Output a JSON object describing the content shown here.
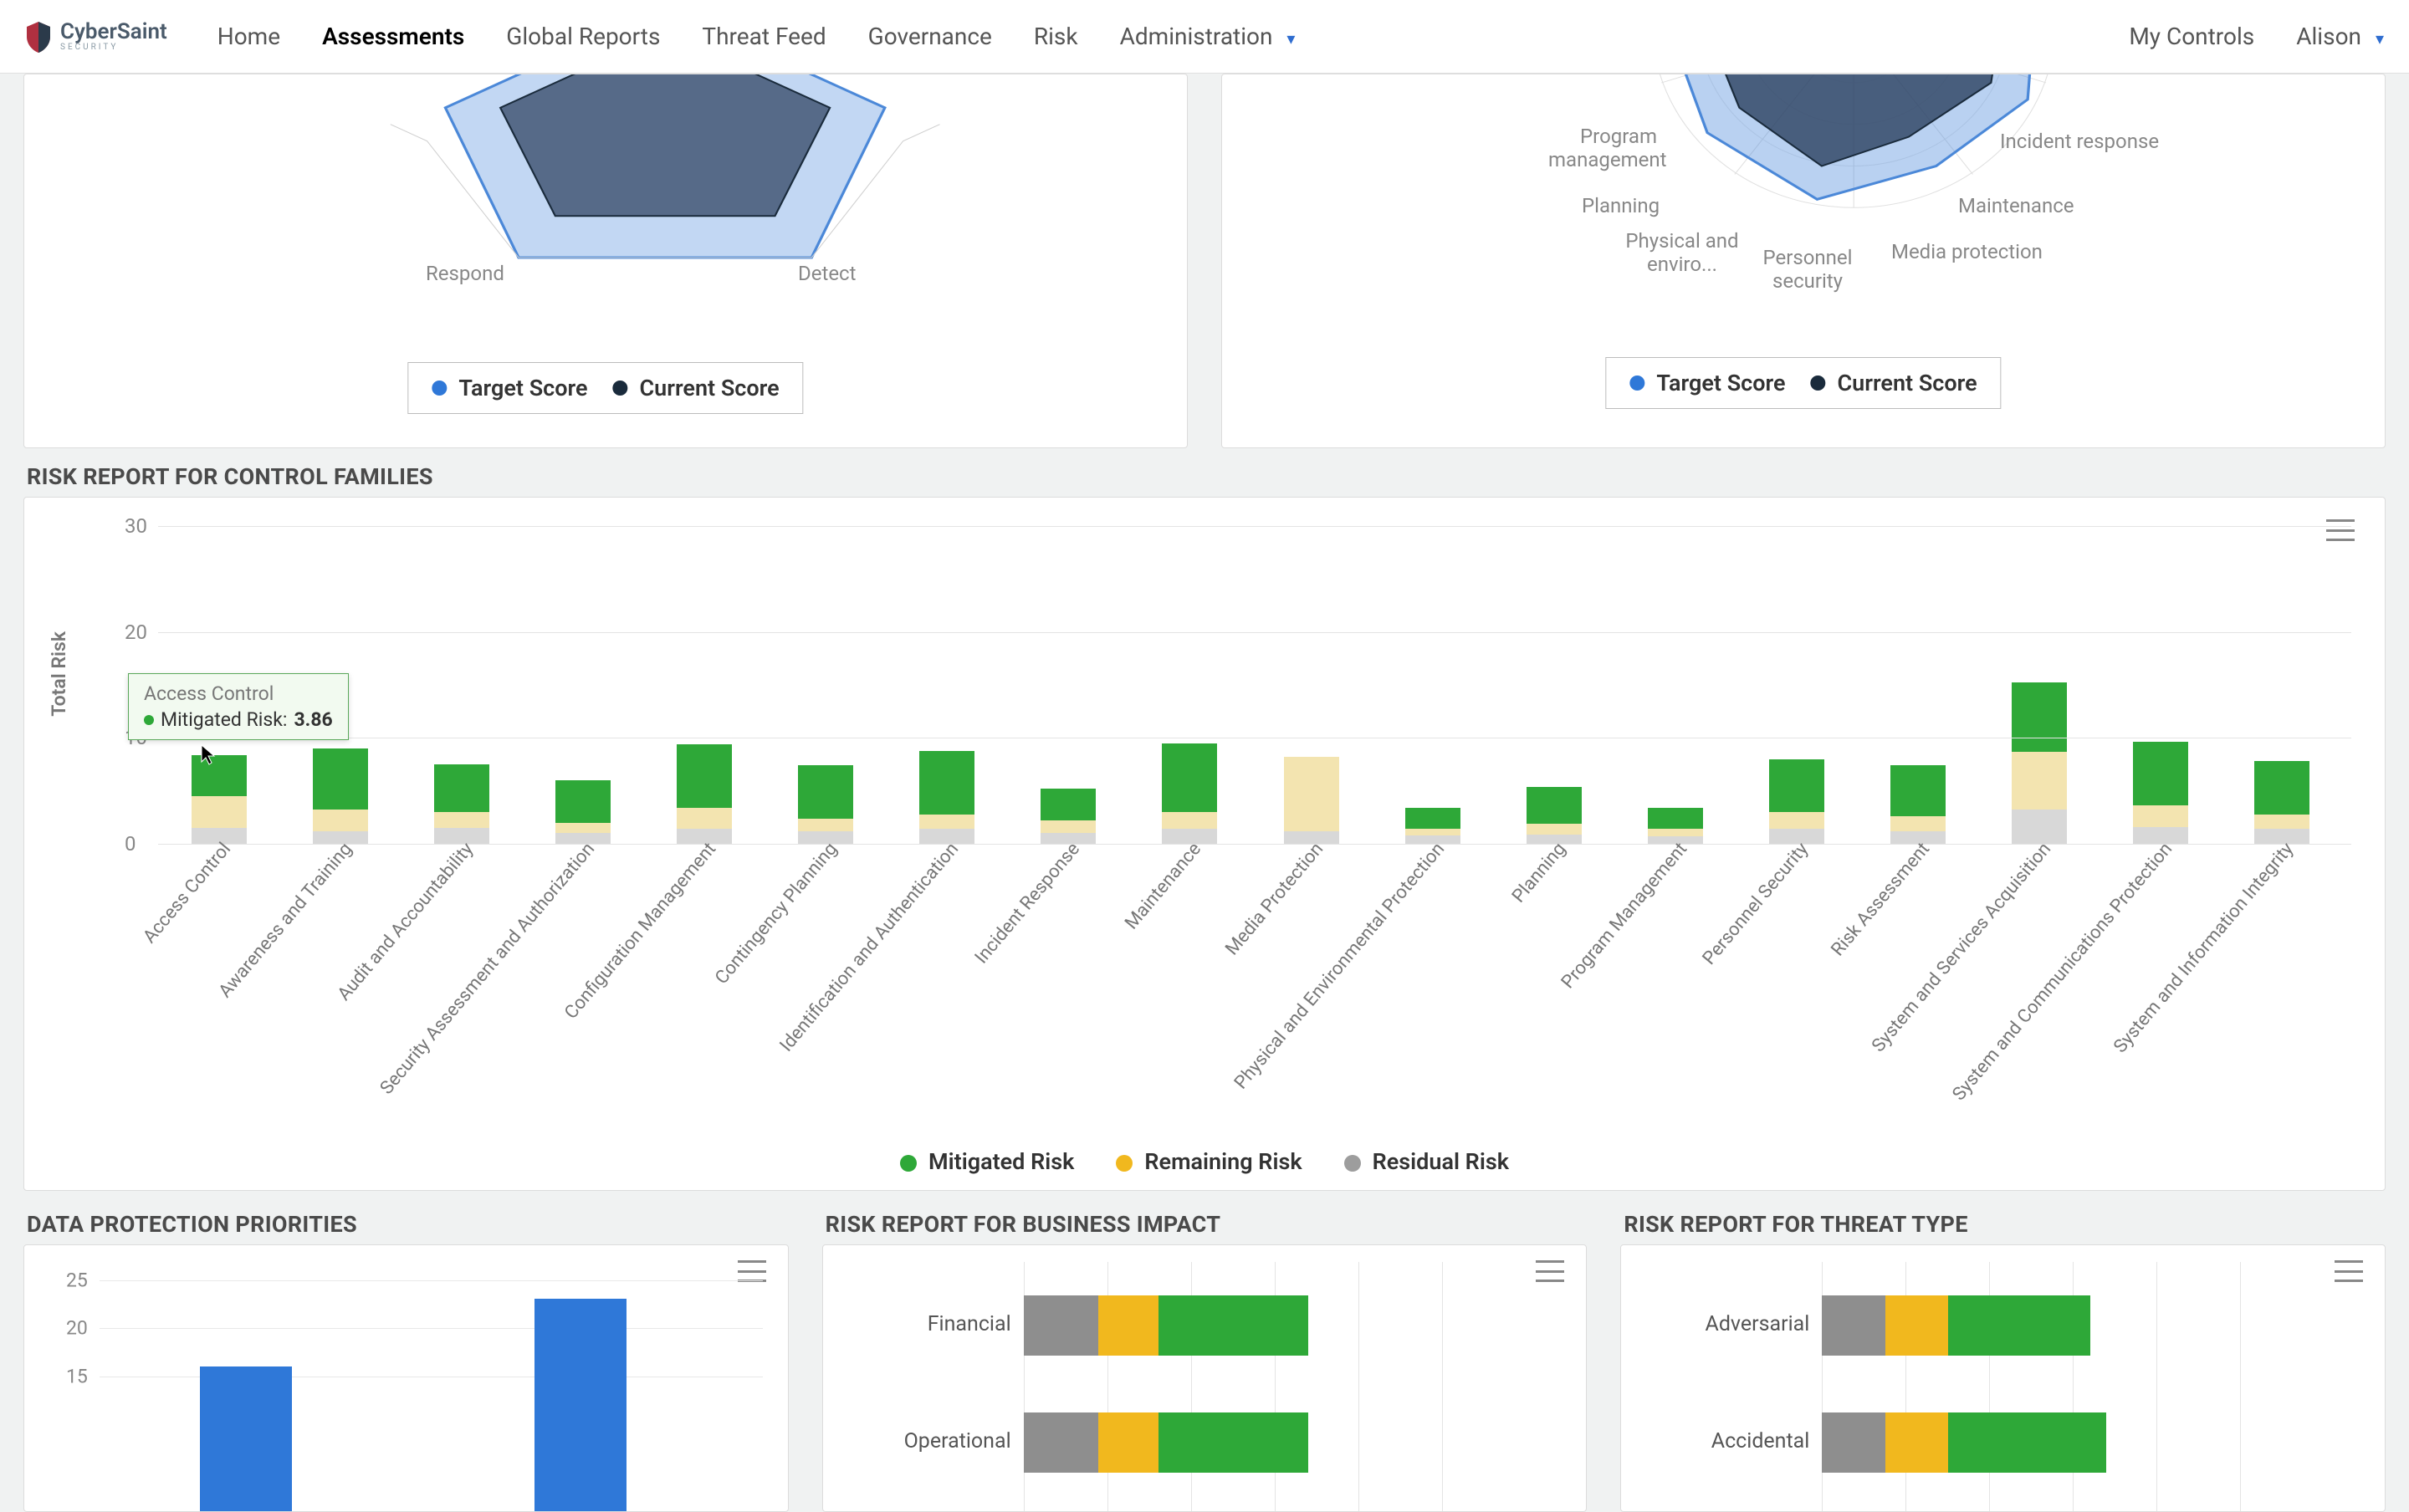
{
  "brand": {
    "name": "CyberSaint",
    "sub": "SECURITY"
  },
  "nav": {
    "items": [
      "Home",
      "Assessments",
      "Global Reports",
      "Threat Feed",
      "Governance",
      "Risk",
      "Administration"
    ],
    "active": "Assessments",
    "right": {
      "my_controls": "My Controls",
      "user": "Alison"
    }
  },
  "colors": {
    "mitigated": "#2ea838",
    "remaining": "#f1b81e",
    "residual": "#9d9d9d",
    "blue": "#2f78d8",
    "dark": "#1a2b3c"
  },
  "radar_left": {
    "labels": {
      "respond": "Respond",
      "detect": "Detect"
    },
    "legend": {
      "target": "Target Score",
      "current": "Current Score"
    }
  },
  "radar_right": {
    "labels": {
      "program_mgmt": "Program management",
      "planning": "Planning",
      "physical_env": "Physical and enviro...",
      "personnel_sec": "Personnel security",
      "media_prot": "Media protection",
      "maintenance": "Maintenance",
      "incident_resp": "Incident response"
    },
    "legend": {
      "target": "Target Score",
      "current": "Current Score"
    }
  },
  "risk_families": {
    "title": "RISK REPORT FOR CONTROL FAMILIES",
    "ylabel": "Total Risk",
    "yticks": [
      0,
      10,
      20,
      30
    ],
    "legend": {
      "mitigated": "Mitigated Risk",
      "remaining": "Remaining Risk",
      "residual": "Residual Risk"
    },
    "tooltip": {
      "category": "Access Control",
      "series": "Mitigated Risk:",
      "value": "3.86"
    }
  },
  "data_protection": {
    "title": "DATA PROTECTION PRIORITIES",
    "yticks": [
      15,
      20,
      25
    ]
  },
  "business_impact": {
    "title": "RISK REPORT FOR BUSINESS IMPACT",
    "rows": [
      "Financial",
      "Operational"
    ]
  },
  "threat_type": {
    "title": "RISK REPORT FOR THREAT TYPE",
    "rows": [
      "Adversarial",
      "Accidental"
    ]
  },
  "chart_data": [
    {
      "type": "bar",
      "title": "RISK REPORT FOR CONTROL FAMILIES",
      "ylabel": "Total Risk",
      "ylim": [
        0,
        30
      ],
      "stacked": true,
      "categories": [
        "Access Control",
        "Awareness and Training",
        "Audit and Accountability",
        "Security Assessment and Authorization",
        "Configuration Management",
        "Contingency Planning",
        "Identification and Authentication",
        "Incident Response",
        "Maintenance",
        "Media Protection",
        "Physical and Environmental Protection",
        "Planning",
        "Program Management",
        "Personnel Security",
        "Risk Assessment",
        "System and Services Acquisition",
        "System and Communications Protection",
        "System and Information Integrity"
      ],
      "series": [
        {
          "name": "Residual Risk",
          "color": "#9d9d9d",
          "values": [
            1.5,
            1.2,
            1.5,
            1.0,
            1.4,
            1.2,
            1.4,
            1.0,
            1.4,
            1.2,
            0.8,
            0.9,
            0.7,
            1.4,
            1.2,
            3.2,
            1.6,
            1.4
          ]
        },
        {
          "name": "Remaining Risk",
          "color": "#f1b81e",
          "values": [
            3.0,
            2.0,
            1.5,
            1.0,
            2.0,
            1.2,
            1.4,
            1.2,
            1.6,
            7.0,
            0.6,
            1.0,
            0.7,
            1.6,
            1.4,
            5.5,
            2.0,
            1.4
          ]
        },
        {
          "name": "Mitigated Risk",
          "color": "#2ea838",
          "values": [
            3.86,
            5.8,
            4.5,
            4.0,
            6.0,
            5.0,
            6.0,
            3.0,
            6.5,
            0.0,
            2.0,
            3.5,
            2.0,
            5.0,
            4.8,
            6.5,
            6.0,
            5.0
          ]
        }
      ],
      "hover": {
        "category": "Access Control",
        "series": "Mitigated Risk",
        "value": 3.86
      }
    },
    {
      "type": "bar",
      "title": "DATA PROTECTION PRIORITIES",
      "ylim": [
        0,
        26
      ],
      "yticks_visible": [
        15,
        20,
        25
      ],
      "categories": [
        "",
        ""
      ],
      "series": [
        {
          "name": "Priority",
          "color": "#2f78d8",
          "values": [
            15,
            22
          ]
        }
      ]
    },
    {
      "type": "bar",
      "orientation": "horizontal",
      "stacked": true,
      "title": "RISK REPORT FOR BUSINESS IMPACT",
      "categories": [
        "Financial",
        "Operational"
      ],
      "series": [
        {
          "name": "Residual Risk",
          "color": "#8e8e8e",
          "values": [
            5,
            5
          ]
        },
        {
          "name": "Remaining Risk",
          "color": "#f1b81e",
          "values": [
            4,
            4
          ]
        },
        {
          "name": "Mitigated Risk",
          "color": "#2ea838",
          "values": [
            10,
            10
          ]
        }
      ]
    },
    {
      "type": "bar",
      "orientation": "horizontal",
      "stacked": true,
      "title": "RISK REPORT FOR THREAT TYPE",
      "categories": [
        "Adversarial",
        "Accidental"
      ],
      "series": [
        {
          "name": "Residual Risk",
          "color": "#8e8e8e",
          "values": [
            4,
            4
          ]
        },
        {
          "name": "Remaining Risk",
          "color": "#f1b81e",
          "values": [
            4,
            4
          ]
        },
        {
          "name": "Mitigated Risk",
          "color": "#2ea838",
          "values": [
            9,
            10
          ]
        }
      ]
    }
  ]
}
